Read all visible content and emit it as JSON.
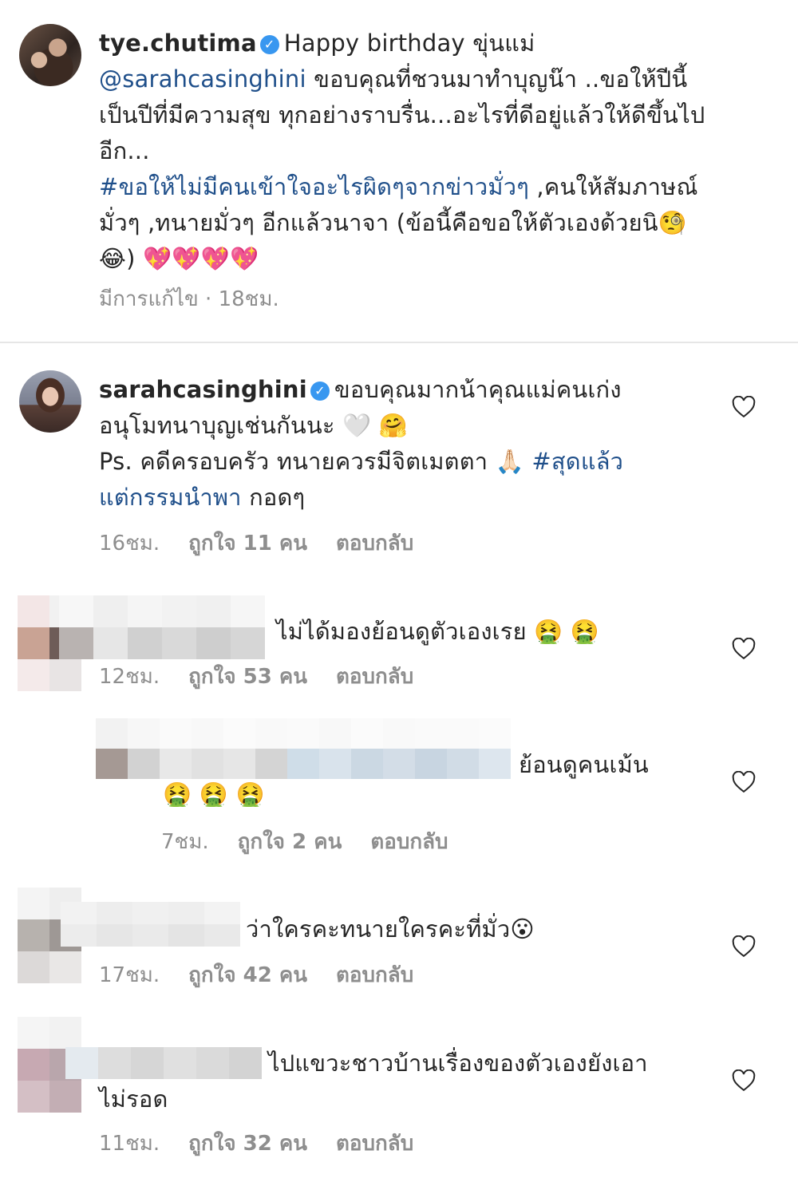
{
  "post_caption": {
    "username": "tye.chutima",
    "line1": "Happy birthday ขุ่นแม่",
    "mention": "@sarahcasinghini",
    "line2": "ขอบคุณที่ชวนมาทำบุญน๊า ..ขอให้ปีนี้",
    "line3": "เป็นปีที่มีความสุข ทุกอย่างราบรื่น...อะไรที่ดีอยู่แล้วให้ดีขึ้นไป",
    "line4": "อีก...",
    "hashtag": "#ขอให้ไม่มีคนเข้าใจอะไรผิดๆจากข่าวมั่วๆ",
    "line5": ",คนให้สัมภาษณ์",
    "line6": "มั่วๆ ,ทนายมั่วๆ อีกแล้วนาจา (ข้อนี้คือขอให้ตัวเองด้วยนิ🧐",
    "line7": "😂) 💖💖💖💖",
    "edited": "มีการแก้ไข · 18ชม."
  },
  "comments": [
    {
      "username": "sarahcasinghini",
      "line1": "ขอบคุณมากน้าคุณแม่คนเก่ง",
      "line2": "อนุโมทนาบุญเช่นกันนะ 🤍 🤗",
      "line3": "Ps. คดีครอบครัว ทนายควรมีจิตเมตตา 🙏🏻",
      "hashtag_a": "#สุดแล้ว",
      "hashtag_b": "แต่กรรมนำพา",
      "line4": "กอดๆ",
      "time": "16ชม.",
      "likes": "ถูกใจ 11 คน",
      "reply": "ตอบกลับ"
    },
    {
      "text": "ไม่ได้มองย้อนดูตัวเองเรย 🤮 🤮",
      "time": "12ชม.",
      "likes": "ถูกใจ 53 คน",
      "reply": "ตอบกลับ"
    },
    {
      "text": "ย้อนดูคนเม้น",
      "emojis": "🤮 🤮 🤮",
      "time": "7ชม.",
      "likes": "ถูกใจ 2 คน",
      "reply": "ตอบกลับ"
    },
    {
      "text": "ว่าใครคะทนายใครคะที่มั่ว😮",
      "time": "17ชม.",
      "likes": "ถูกใจ 42 คน",
      "reply": "ตอบกลับ"
    },
    {
      "text": "ไปแขวะชาวบ้านเรื่องของตัวเองยังเอา",
      "text2": "ไม่รอด",
      "time": "11ชม.",
      "likes": "ถูกใจ 32 คน",
      "reply": "ตอบกลับ"
    }
  ],
  "icons": {
    "verified": "verified-badge-icon",
    "like": "heart-icon"
  },
  "colors": {
    "link": "#1f4f8a",
    "verified": "#3897f0",
    "meta": "#8e8e8e"
  }
}
